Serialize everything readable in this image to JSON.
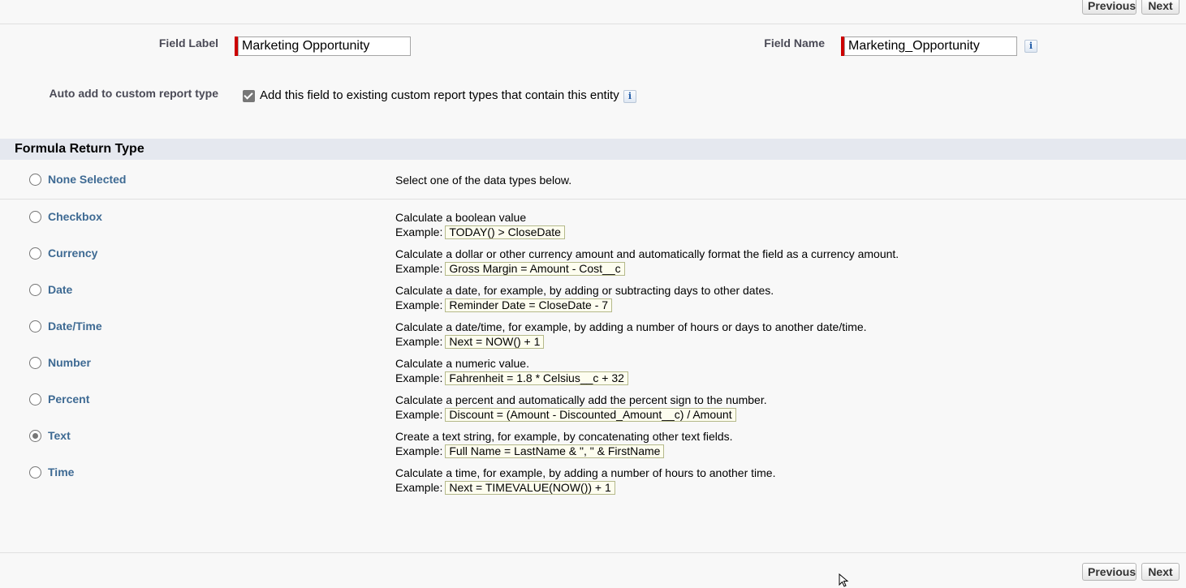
{
  "nav": {
    "previous_label": "Previous",
    "next_label": "Next"
  },
  "fields": {
    "field_label_caption": "Field Label",
    "field_label_value": "Marketing Opportunity",
    "field_name_caption": "Field Name",
    "field_name_value": "Marketing_Opportunity",
    "info_glyph": "i",
    "auto_add_caption": "Auto add to custom report type",
    "auto_add_text": "Add this field to existing custom report types that contain this entity",
    "auto_add_checked": true
  },
  "section": {
    "title": "Formula Return Type"
  },
  "none_option": {
    "label": "None Selected",
    "description": "Select one of the data types below."
  },
  "example_prefix": "Example:",
  "return_types": [
    {
      "label": "Checkbox",
      "description": "Calculate a boolean value",
      "example": "TODAY() > CloseDate",
      "selected": false
    },
    {
      "label": "Currency",
      "description": "Calculate a dollar or other currency amount and automatically format the field as a currency amount.",
      "example": "Gross Margin = Amount - Cost__c",
      "selected": false
    },
    {
      "label": "Date",
      "description": "Calculate a date, for example, by adding or subtracting days to other dates.",
      "example": "Reminder Date = CloseDate - 7",
      "selected": false
    },
    {
      "label": "Date/Time",
      "description": "Calculate a date/time, for example, by adding a number of hours or days to another date/time.",
      "example": "Next = NOW() + 1",
      "selected": false
    },
    {
      "label": "Number",
      "description": "Calculate a numeric value.",
      "example": "Fahrenheit = 1.8 * Celsius__c + 32",
      "selected": false
    },
    {
      "label": "Percent",
      "description": "Calculate a percent and automatically add the percent sign to the number.",
      "example": "Discount = (Amount - Discounted_Amount__c) / Amount",
      "selected": false
    },
    {
      "label": "Text",
      "description": "Create a text string, for example, by concatenating other text fields.",
      "example": "Full Name = LastName & \", \" & FirstName",
      "selected": true
    },
    {
      "label": "Time",
      "description": "Calculate a time, for example, by adding a number of hours to another time.",
      "example": "Next = TIMEVALUE(NOW()) + 1",
      "selected": false
    }
  ]
}
